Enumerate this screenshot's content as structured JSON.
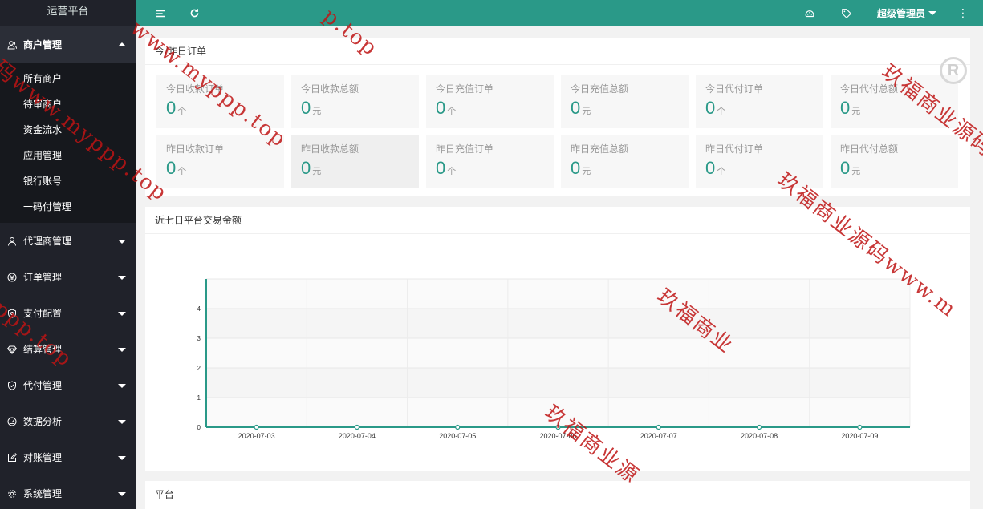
{
  "app": {
    "title": "运营平台"
  },
  "sidebar": {
    "groups": [
      {
        "label": "商户管理",
        "icon": "user-group-icon",
        "open": true,
        "items": [
          {
            "label": "所有商户"
          },
          {
            "label": "待审商户"
          },
          {
            "label": "资金流水"
          },
          {
            "label": "应用管理"
          },
          {
            "label": "银行账号"
          },
          {
            "label": "一码付管理"
          }
        ]
      },
      {
        "label": "代理商管理",
        "icon": "user-icon"
      },
      {
        "label": "订单管理",
        "icon": "yen-icon"
      },
      {
        "label": "支付配置",
        "icon": "shield-icon"
      },
      {
        "label": "结算管理",
        "icon": "diamond-icon"
      },
      {
        "label": "代付管理",
        "icon": "shield-check-icon"
      },
      {
        "label": "数据分析",
        "icon": "dashboard-icon"
      },
      {
        "label": "对账管理",
        "icon": "edit-icon"
      },
      {
        "label": "系统管理",
        "icon": "gear-icon"
      }
    ]
  },
  "topbar": {
    "user": "超级管理员",
    "more": "⋮"
  },
  "stats": {
    "title": "今/昨日订单",
    "items": [
      {
        "label": "今日收款订单",
        "value": "0",
        "unit": "个"
      },
      {
        "label": "今日收款总额",
        "value": "0",
        "unit": "元"
      },
      {
        "label": "今日充值订单",
        "value": "0",
        "unit": "个"
      },
      {
        "label": "今日充值总额",
        "value": "0",
        "unit": "元"
      },
      {
        "label": "今日代付订单",
        "value": "0",
        "unit": "个"
      },
      {
        "label": "今日代付总额",
        "value": "0",
        "unit": "元"
      },
      {
        "label": "昨日收款订单",
        "value": "0",
        "unit": "个"
      },
      {
        "label": "昨日收款总额",
        "value": "0",
        "unit": "元"
      },
      {
        "label": "昨日充值订单",
        "value": "0",
        "unit": "个"
      },
      {
        "label": "昨日充值总额",
        "value": "0",
        "unit": "元"
      },
      {
        "label": "昨日代付订单",
        "value": "0",
        "unit": "个"
      },
      {
        "label": "昨日代付总额",
        "value": "0",
        "unit": "元"
      }
    ]
  },
  "chart_data": {
    "type": "line",
    "title": "近七日平台交易金额",
    "categories": [
      "2020-07-03",
      "2020-07-04",
      "2020-07-05",
      "2020-07-06",
      "2020-07-07",
      "2020-07-08",
      "2020-07-09"
    ],
    "values": [
      0,
      0,
      0,
      0,
      0,
      0,
      0
    ],
    "ylim": [
      0,
      5
    ],
    "yticks": [
      0,
      1,
      2,
      3,
      4
    ],
    "grid": true,
    "color": "#2a9988"
  },
  "platform": {
    "title": "平台"
  },
  "watermarks": [
    "www.myppp.top",
    "码www.myppp.top",
    "ppp.top",
    "p.top",
    "玖福商业源码www.",
    "玖福商业源码www.m",
    "玖福商业源",
    "玖福商业"
  ],
  "colors": {
    "accent": "#2a9988",
    "sidebar": "#20222a",
    "sidebar_open": "#16181d"
  }
}
